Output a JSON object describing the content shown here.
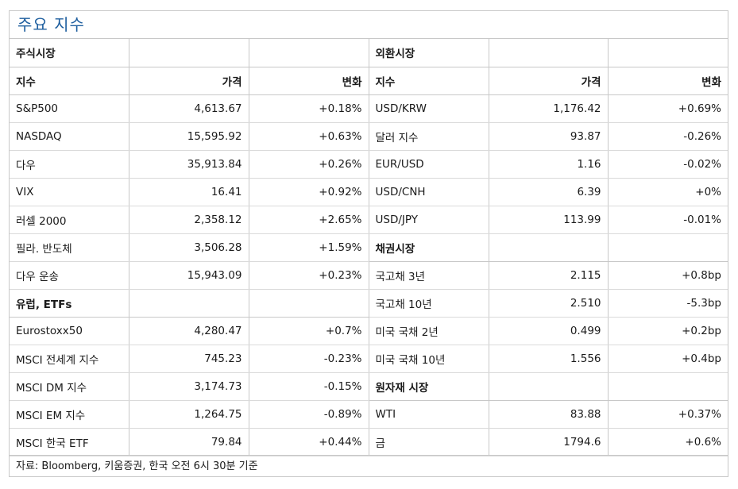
{
  "title": "주요 지수",
  "sections": {
    "stock": "주식시장",
    "fx": "외환시장",
    "europe": "유럽, ETFs",
    "bond": "채권시장",
    "commodity": "원자재 시장"
  },
  "headers": {
    "left": [
      "지수",
      "가격",
      "변화"
    ],
    "right": [
      "지수",
      "가격",
      "변화"
    ]
  },
  "stock_rows": [
    [
      "S&P500",
      "4,613.67",
      "+0.18%"
    ],
    [
      "NASDAQ",
      "15,595.92",
      "+0.63%"
    ],
    [
      "다우",
      "35,913.84",
      "+0.26%"
    ],
    [
      "VIX",
      "16.41",
      "+0.92%"
    ],
    [
      "러셀 2000",
      "2,358.12",
      "+2.65%"
    ],
    [
      "필라. 반도체",
      "3,506.28",
      "+1.59%"
    ],
    [
      "다우 운송",
      "15,943.09",
      "+0.23%"
    ]
  ],
  "europe_rows": [
    [
      "Eurostoxx50",
      "4,280.47",
      "+0.7%"
    ],
    [
      "MSCI 전세계 지수",
      "745.23",
      "-0.23%"
    ],
    [
      "MSCI DM 지수",
      "3,174.73",
      "-0.15%"
    ],
    [
      "MSCI EM 지수",
      "1,264.75",
      "-0.89%"
    ],
    [
      "MSCI 한국 ETF",
      "79.84",
      "+0.44%"
    ]
  ],
  "fx_rows": [
    [
      "USD/KRW",
      "1,176.42",
      "+0.69%"
    ],
    [
      "달러 지수",
      "93.87",
      "-0.26%"
    ],
    [
      "EUR/USD",
      "1.16",
      "-0.02%"
    ],
    [
      "USD/CNH",
      "6.39",
      "+0%"
    ],
    [
      "USD/JPY",
      "113.99",
      "-0.01%"
    ]
  ],
  "bond_rows": [
    [
      "국고채 3년",
      "2.115",
      "+0.8bp"
    ],
    [
      "국고채 10년",
      "2.510",
      "-5.3bp"
    ],
    [
      "미국 국채 2년",
      "0.499",
      "+0.2bp"
    ],
    [
      "미국 국채 10년",
      "1.556",
      "+0.4bp"
    ]
  ],
  "commodity_rows": [
    [
      "WTI",
      "83.88",
      "+0.37%"
    ],
    [
      "금",
      "1794.6",
      "+0.6%"
    ]
  ],
  "footer": "자료: Bloomberg, 키움증권, 한국 오전 6시 30분 기준"
}
